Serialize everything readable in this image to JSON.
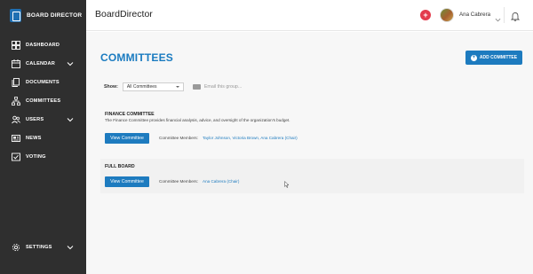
{
  "brand": {
    "name": "BOARD DIRECTOR",
    "logo_icon": "board-director-logo"
  },
  "sidebar": {
    "items": [
      {
        "label": "DASHBOARD",
        "icon": "dashboard-icon"
      },
      {
        "label": "CALENDAR",
        "icon": "calendar-icon",
        "expandable": true
      },
      {
        "label": "DOCUMENTS",
        "icon": "documents-icon"
      },
      {
        "label": "COMMITTEES",
        "icon": "committees-icon"
      },
      {
        "label": "USERS",
        "icon": "users-icon",
        "expandable": true
      },
      {
        "label": "NEWS",
        "icon": "news-icon"
      },
      {
        "label": "VOTING",
        "icon": "voting-icon"
      }
    ],
    "settings": {
      "label": "SETTINGS",
      "icon": "settings-icon",
      "expandable": true
    }
  },
  "header": {
    "title": "BoardDirector",
    "user_name": "Ana Cabrera",
    "plus_glyph": "+"
  },
  "main": {
    "page_title": "COMMITTEES",
    "add_button_label": "ADD COMMITTEE",
    "add_button_glyph": "+",
    "filter": {
      "show_label": "Show:",
      "selected_option": "All Committees",
      "email_link": "Email this group..."
    },
    "committees": [
      {
        "title": "FINANCE COMMITTEE",
        "description": "The Finance Committee provides financial analysis, advice, and oversight of the organization's budget.",
        "view_button": "View Committee",
        "members_label": "Committee Members:",
        "members": "Taylor Johnson, Victoria Brown, Ana Cabrera (Chair)"
      },
      {
        "title": "FULL BOARD",
        "view_button": "View Committee",
        "members_label": "Committee Members:",
        "members": "Ana Cabrera (Chair)"
      }
    ]
  },
  "colors": {
    "sidebar_bg": "#2f2f2f",
    "accent_blue": "#1d7bbf",
    "title_blue": "#1a7bc0",
    "plus_red": "#e33b4c"
  }
}
